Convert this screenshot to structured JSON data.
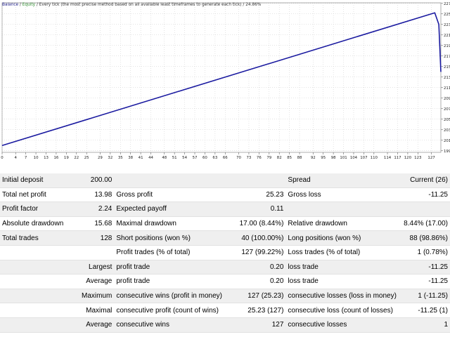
{
  "window": {
    "legend_balance": "Balance",
    "legend_sep1": " / ",
    "legend_equity": "Equity",
    "legend_sep2": " / ",
    "legend_model": "Every tick (the most precise method based on all available least timeframes to generate each tick)",
    "legend_sep3": " / ",
    "legend_quality": "24.86%",
    "colors": {
      "balance": "#1a1aa0",
      "equity": "#2e8b2e",
      "legend_text": "#1f1f8a",
      "grid": "#c9c9c9"
    }
  },
  "chart_data": {
    "type": "line",
    "series": [
      {
        "name": "Balance",
        "x": [
          0,
          128,
          129.2,
          129.8
        ],
        "y": [
          200,
          225.2,
          223,
          213.98
        ]
      }
    ],
    "xlim": [
      0,
      129.8
    ],
    "ylim": [
      198.7,
      227.1
    ],
    "x_ticks": [
      0,
      4,
      7,
      10,
      13,
      16,
      19,
      22,
      25,
      29,
      32,
      35,
      38,
      41,
      44,
      48,
      51,
      54,
      57,
      60,
      63,
      66,
      70,
      73,
      76,
      79,
      82,
      85,
      88,
      92,
      95,
      98,
      101,
      104,
      107,
      110,
      114,
      117,
      120,
      123,
      127
    ],
    "y_ticks": [
      199,
      201,
      203,
      205,
      207,
      209,
      211,
      213,
      215,
      217,
      219,
      221,
      223,
      225,
      227
    ],
    "grid": true
  },
  "report": {
    "rows": [
      [
        "Initial deposit",
        "200.00",
        "",
        "",
        "Spread",
        "Current (26)"
      ],
      [
        "Total net profit",
        "13.98",
        "Gross profit",
        "25.23",
        "Gross loss",
        "-11.25"
      ],
      [
        "Profit factor",
        "2.24",
        "Expected payoff",
        "0.11",
        "",
        ""
      ],
      [
        "Absolute drawdown",
        "15.68",
        "Maximal drawdown",
        "17.00 (8.44%)",
        "Relative drawdown",
        "8.44% (17.00)"
      ],
      [
        "Total trades",
        "128",
        "Short positions (won %)",
        "40 (100.00%)",
        "Long positions (won %)",
        "88 (98.86%)"
      ],
      [
        "",
        "",
        "Profit trades (% of total)",
        "127 (99.22%)",
        "Loss trades (% of total)",
        "1 (0.78%)"
      ],
      [
        "",
        "Largest",
        "profit trade",
        "0.20",
        "loss trade",
        "-11.25"
      ],
      [
        "",
        "Average",
        "profit trade",
        "0.20",
        "loss trade",
        "-11.25"
      ],
      [
        "",
        "Maximum",
        "consecutive wins (profit in money)",
        "127 (25.23)",
        "consecutive losses (loss in money)",
        "1 (-11.25)"
      ],
      [
        "",
        "Maximal",
        "consecutive profit (count of wins)",
        "25.23 (127)",
        "consecutive loss (count of losses)",
        "-11.25 (1)"
      ],
      [
        "",
        "Average",
        "consecutive wins",
        "127",
        "consecutive losses",
        "1"
      ]
    ]
  }
}
